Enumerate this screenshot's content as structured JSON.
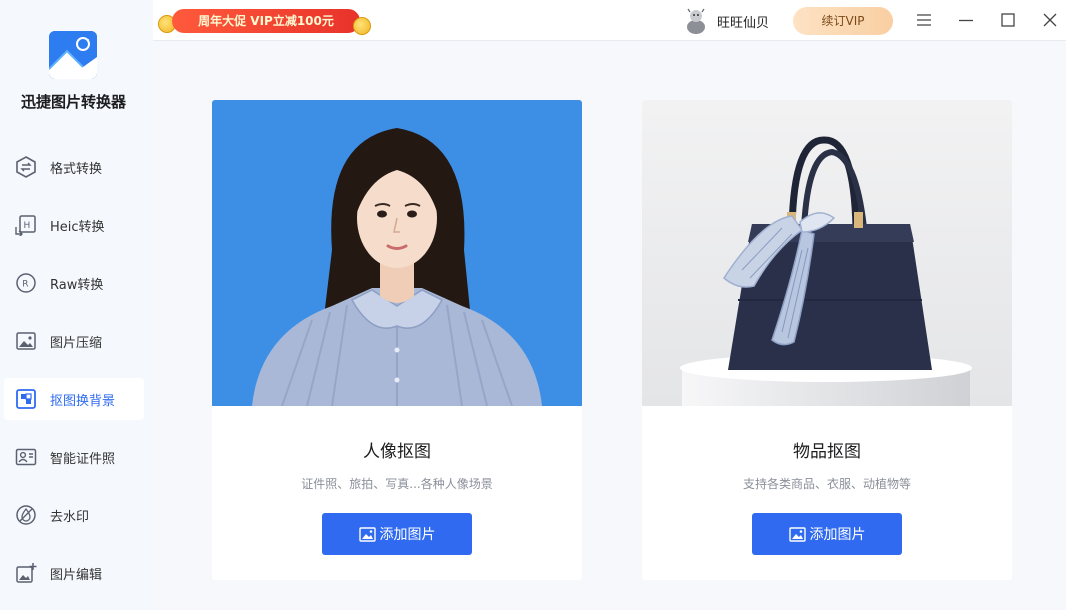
{
  "app": {
    "name": "迅捷图片转换器"
  },
  "sidebar": {
    "items": [
      {
        "label": "格式转换",
        "icon": "format-convert-icon",
        "active": false
      },
      {
        "label": "Heic转换",
        "icon": "heic-icon",
        "active": false
      },
      {
        "label": "Raw转换",
        "icon": "raw-icon",
        "active": false
      },
      {
        "label": "图片压缩",
        "icon": "compress-icon",
        "active": false
      },
      {
        "label": "抠图换背景",
        "icon": "cutout-icon",
        "active": true
      },
      {
        "label": "智能证件照",
        "icon": "id-photo-icon",
        "active": false
      },
      {
        "label": "去水印",
        "icon": "watermark-icon",
        "active": false
      },
      {
        "label": "图片编辑",
        "icon": "image-edit-icon",
        "active": false
      }
    ]
  },
  "topbar": {
    "promo": "周年大促 VIP立减100元",
    "username": "旺旺仙贝",
    "vip_button": "续订VIP"
  },
  "cards": [
    {
      "title": "人像抠图",
      "desc": "证件照、旅拍、写真...各种人像场景",
      "button": "添加图片"
    },
    {
      "title": "物品抠图",
      "desc": "支持各类商品、衣服、动植物等",
      "button": "添加图片"
    }
  ],
  "colors": {
    "accent": "#2f6af0",
    "portrait_bg": "#3d8fe6",
    "sidebar_bg": "#f5f8fd"
  }
}
